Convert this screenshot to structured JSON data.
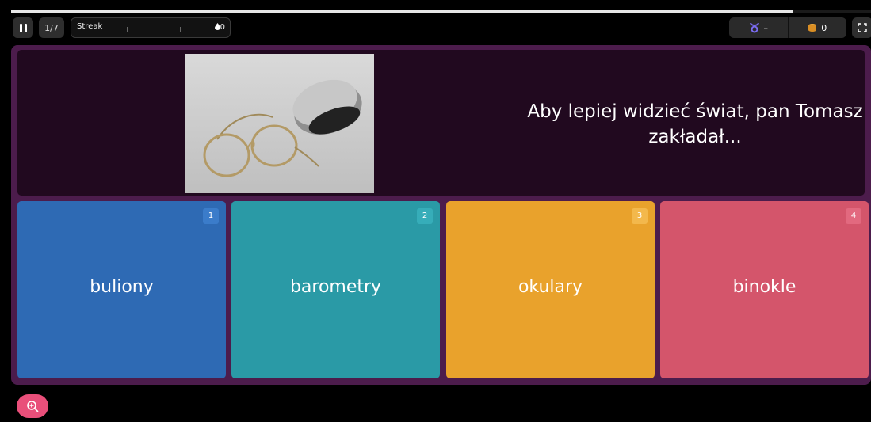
{
  "progress": {
    "fraction": 0.91
  },
  "topbar": {
    "counter": "1/7",
    "streak_label": "Streak",
    "streak_value": "0",
    "powerup_value": "–",
    "coins_value": "0"
  },
  "question": {
    "text": "Aby lepiej widzieć świat, pan Tomasz zakładał..."
  },
  "answers": [
    {
      "number": "1",
      "label": "buliony",
      "color": "#2e6ab4"
    },
    {
      "number": "2",
      "label": "barometry",
      "color": "#2a9aa6"
    },
    {
      "number": "3",
      "label": "okulary",
      "color": "#e9a22c"
    },
    {
      "number": "4",
      "label": "binokle",
      "color": "#d4556b"
    }
  ],
  "colors": {
    "stage": "#4c1c4c",
    "question_panel": "#21091f",
    "zoom_button": "#e94f7a"
  },
  "icons": [
    "pause-icon",
    "drop-icon",
    "powerup-icon",
    "coin-icon",
    "fullscreen-icon",
    "zoom-in-icon"
  ]
}
